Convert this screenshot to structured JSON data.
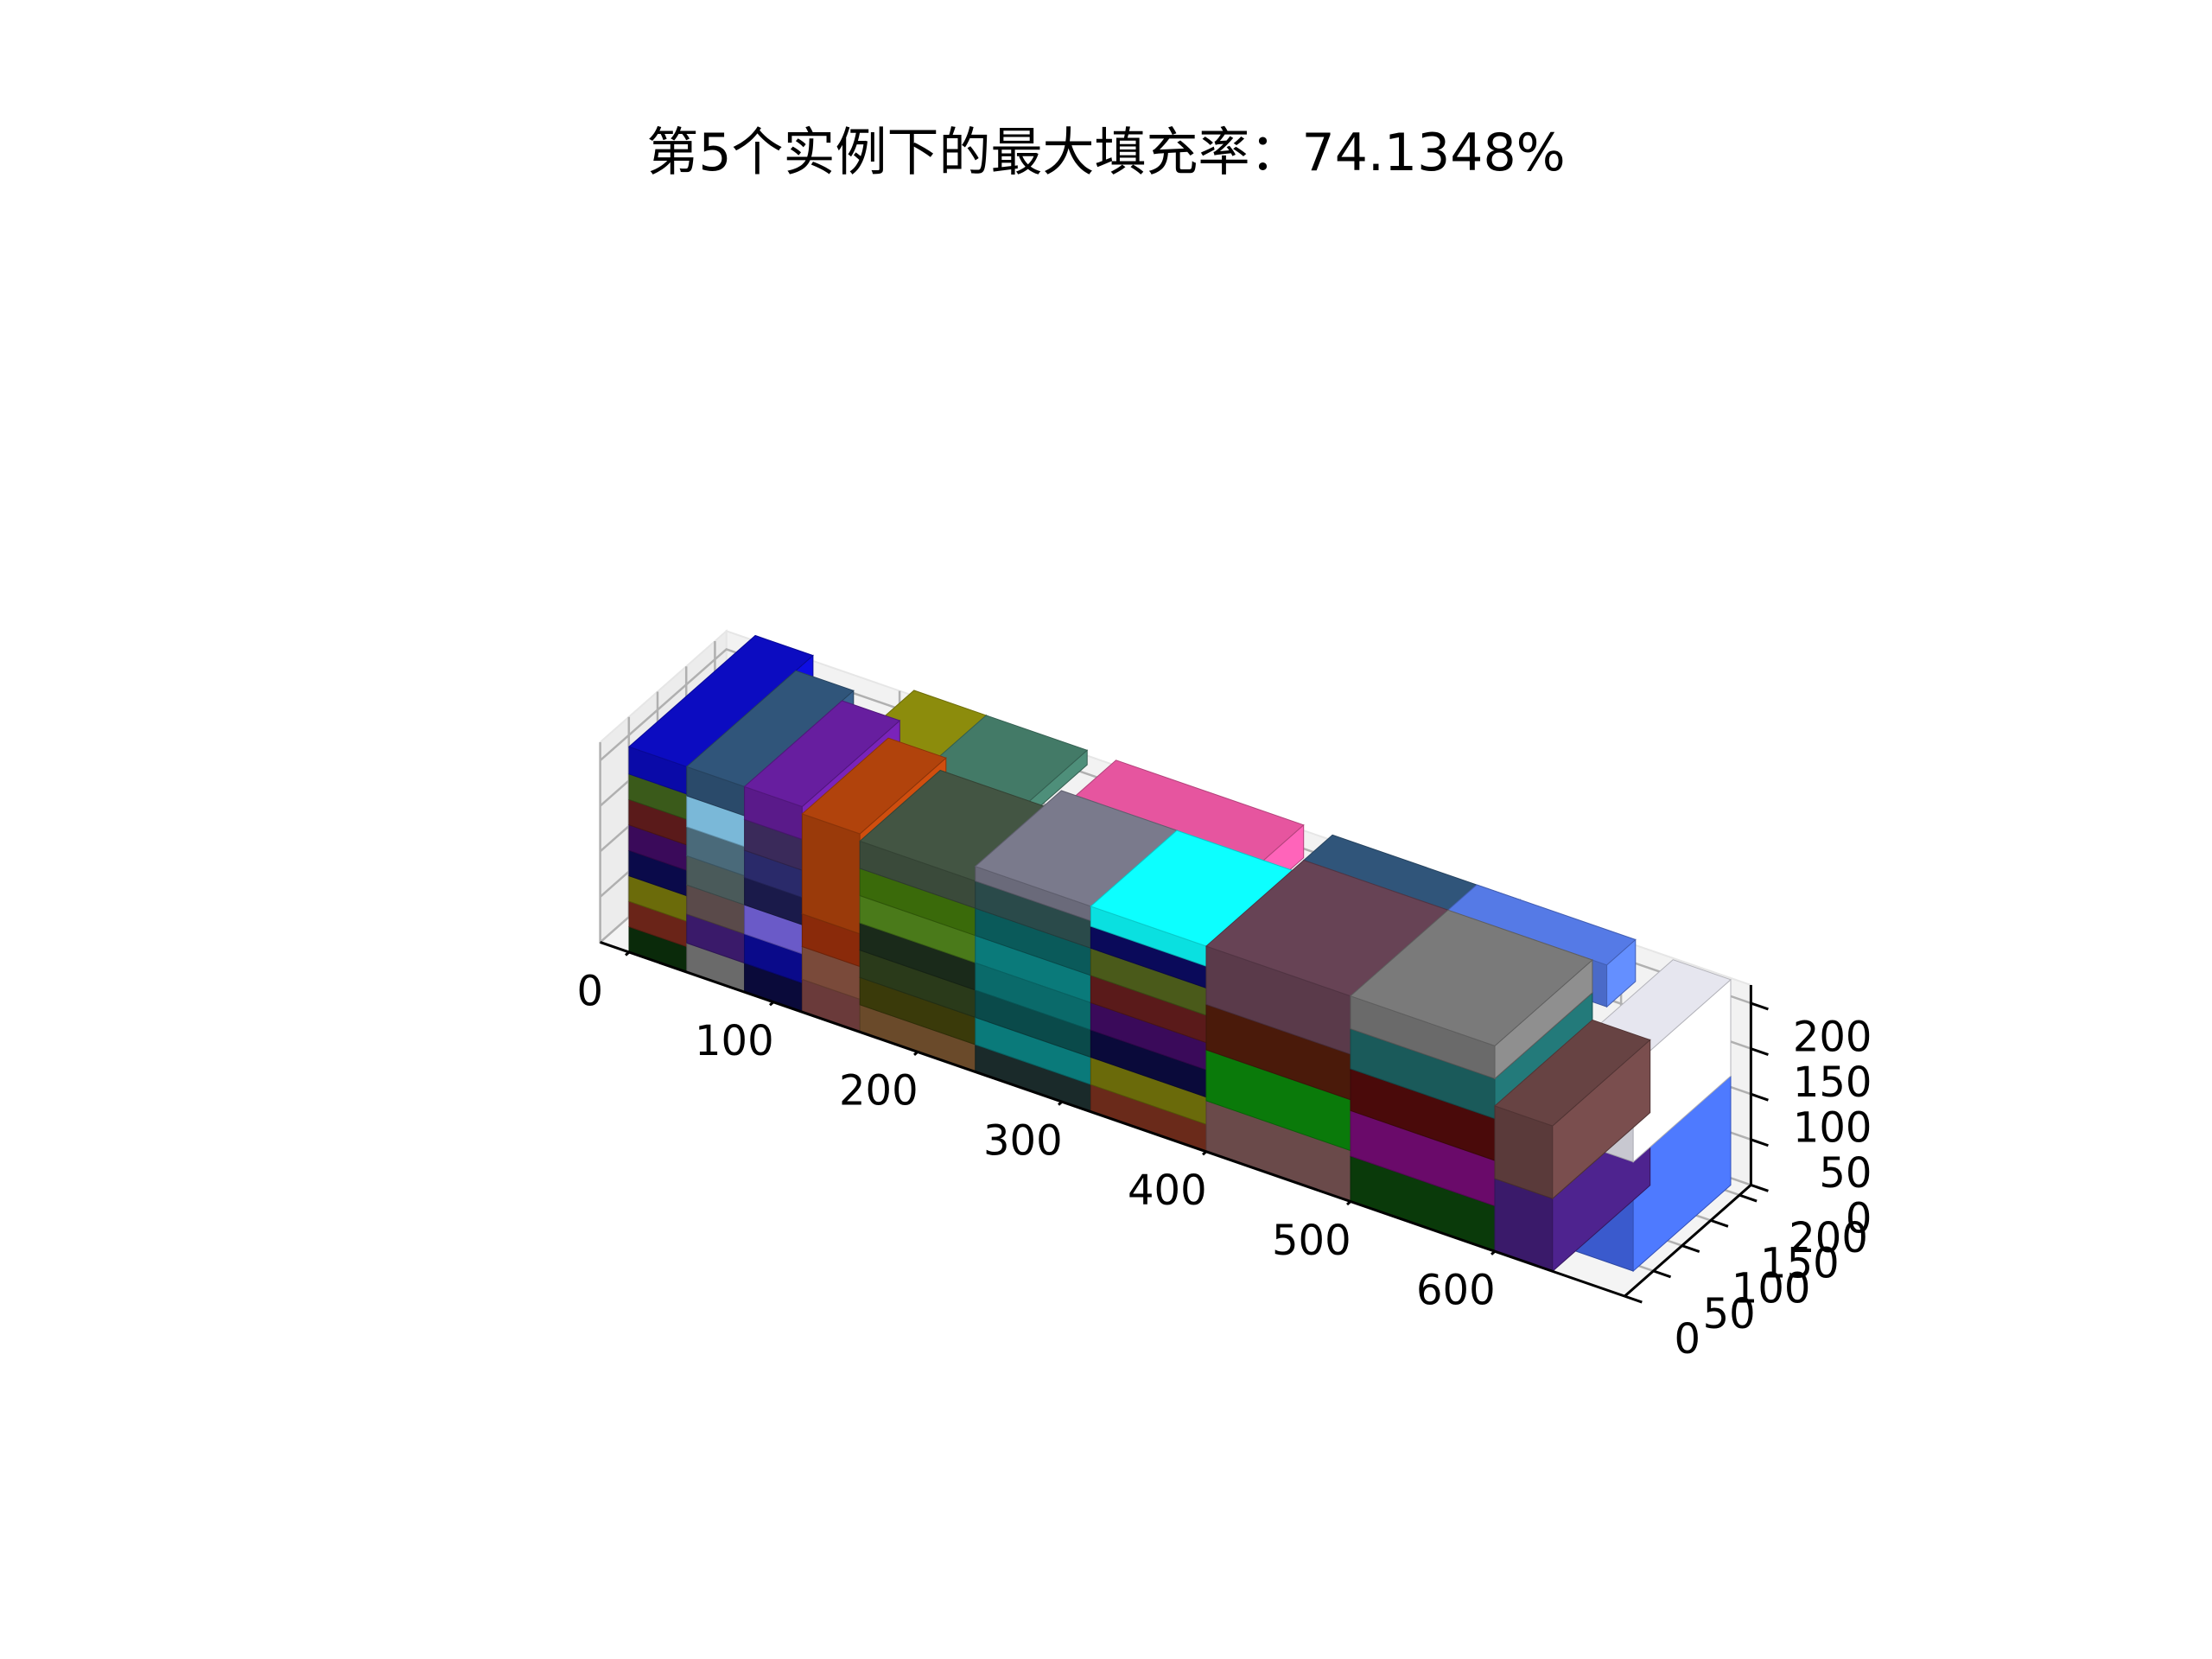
{
  "chart_data": {
    "type": "3d-bar",
    "title": "第5个实例下的最大填充率：74.1348%",
    "xlabel": "",
    "ylabel": "",
    "zlabel": "",
    "x_ticks": [
      "0",
      "100",
      "200",
      "300",
      "400",
      "500",
      "600"
    ],
    "y_ticks": [
      "0",
      "50",
      "100",
      "150",
      "200"
    ],
    "z_ticks": [
      "0",
      "50",
      "100",
      "150",
      "200"
    ],
    "xlim": [
      0,
      600
    ],
    "ylim": [
      0,
      220
    ],
    "zlim": [
      0,
      220
    ],
    "grid": true,
    "boxes": [
      {
        "x": 0,
        "y": 0,
        "z": 0,
        "dx": 40,
        "dy": 220,
        "dz": 28,
        "color": "#0a2a0a"
      },
      {
        "x": 0,
        "y": 0,
        "z": 28,
        "dx": 40,
        "dy": 220,
        "dz": 28,
        "color": "#6a2418"
      },
      {
        "x": 0,
        "y": 0,
        "z": 56,
        "dx": 40,
        "dy": 220,
        "dz": 28,
        "color": "#6b6b0a"
      },
      {
        "x": 0,
        "y": 0,
        "z": 84,
        "dx": 40,
        "dy": 220,
        "dz": 28,
        "color": "#0a0a4a"
      },
      {
        "x": 0,
        "y": 0,
        "z": 112,
        "dx": 40,
        "dy": 220,
        "dz": 28,
        "color": "#3a0a5a"
      },
      {
        "x": 0,
        "y": 0,
        "z": 140,
        "dx": 40,
        "dy": 220,
        "dz": 28,
        "color": "#5a1a1a"
      },
      {
        "x": 0,
        "y": 0,
        "z": 168,
        "dx": 40,
        "dy": 220,
        "dz": 28,
        "color": "#3a5a1a"
      },
      {
        "x": 0,
        "y": 0,
        "z": 196,
        "dx": 40,
        "dy": 220,
        "dz": 30,
        "color": "#0a0aa8"
      },
      {
        "x": 40,
        "y": 0,
        "z": 0,
        "dx": 40,
        "dy": 190,
        "dz": 32,
        "color": "#6a6a6a"
      },
      {
        "x": 40,
        "y": 0,
        "z": 32,
        "dx": 40,
        "dy": 190,
        "dz": 32,
        "color": "#3a1a6a"
      },
      {
        "x": 40,
        "y": 0,
        "z": 64,
        "dx": 40,
        "dy": 190,
        "dz": 32,
        "color": "#5a4a4a"
      },
      {
        "x": 40,
        "y": 0,
        "z": 96,
        "dx": 40,
        "dy": 190,
        "dz": 32,
        "color": "#4a5a5a"
      },
      {
        "x": 40,
        "y": 0,
        "z": 128,
        "dx": 40,
        "dy": 190,
        "dz": 32,
        "color": "#4a6a7a"
      },
      {
        "x": 40,
        "y": 0,
        "z": 160,
        "dx": 40,
        "dy": 190,
        "dz": 34,
        "color": "#7ab8d8"
      },
      {
        "x": 40,
        "y": 0,
        "z": 194,
        "dx": 40,
        "dy": 190,
        "dz": 32,
        "color": "#2a4a6a"
      },
      {
        "x": 80,
        "y": 0,
        "z": 0,
        "dx": 40,
        "dy": 170,
        "dz": 32,
        "color": "#0a0a3a"
      },
      {
        "x": 80,
        "y": 0,
        "z": 32,
        "dx": 40,
        "dy": 170,
        "dz": 32,
        "color": "#0a0a8a"
      },
      {
        "x": 80,
        "y": 0,
        "z": 64,
        "dx": 40,
        "dy": 170,
        "dz": 32,
        "color": "#6a5ac8"
      },
      {
        "x": 80,
        "y": 0,
        "z": 96,
        "dx": 40,
        "dy": 170,
        "dz": 30,
        "color": "#1a1a4a"
      },
      {
        "x": 80,
        "y": 0,
        "z": 126,
        "dx": 40,
        "dy": 170,
        "dz": 30,
        "color": "#2a2a6a"
      },
      {
        "x": 80,
        "y": 0,
        "z": 156,
        "dx": 40,
        "dy": 170,
        "dz": 34,
        "color": "#3a2a5a"
      },
      {
        "x": 80,
        "y": 0,
        "z": 190,
        "dx": 40,
        "dy": 170,
        "dz": 36,
        "color": "#5a1a8a"
      },
      {
        "x": 120,
        "y": 0,
        "z": 0,
        "dx": 40,
        "dy": 150,
        "dz": 36,
        "color": "#6a3a3a"
      },
      {
        "x": 120,
        "y": 0,
        "z": 36,
        "dx": 40,
        "dy": 150,
        "dz": 36,
        "color": "#7a4a3a"
      },
      {
        "x": 120,
        "y": 0,
        "z": 72,
        "dx": 40,
        "dy": 150,
        "dz": 36,
        "color": "#8a2a0a"
      },
      {
        "x": 120,
        "y": 0,
        "z": 108,
        "dx": 40,
        "dy": 150,
        "dz": 110,
        "color": "#9a3a0a"
      },
      {
        "x": 110,
        "y": 80,
        "z": 190,
        "dx": 50,
        "dy": 140,
        "dz": 36,
        "color": "#7a7a0a"
      },
      {
        "x": 160,
        "y": 0,
        "z": 0,
        "dx": 80,
        "dy": 140,
        "dz": 30,
        "color": "#6a4a2a"
      },
      {
        "x": 160,
        "y": 0,
        "z": 30,
        "dx": 80,
        "dy": 140,
        "dz": 30,
        "color": "#3a3a0a"
      },
      {
        "x": 160,
        "y": 0,
        "z": 60,
        "dx": 80,
        "dy": 140,
        "dz": 30,
        "color": "#2a3a1a"
      },
      {
        "x": 160,
        "y": 0,
        "z": 90,
        "dx": 80,
        "dy": 140,
        "dz": 30,
        "color": "#1a2a1a"
      },
      {
        "x": 160,
        "y": 0,
        "z": 120,
        "dx": 80,
        "dy": 140,
        "dz": 30,
        "color": "#4a7a1a"
      },
      {
        "x": 160,
        "y": 0,
        "z": 150,
        "dx": 80,
        "dy": 140,
        "dz": 30,
        "color": "#3a6a0a"
      },
      {
        "x": 160,
        "y": 0,
        "z": 180,
        "dx": 80,
        "dy": 140,
        "dz": 30,
        "color": "#3a4a3a"
      },
      {
        "x": 160,
        "y": 80,
        "z": 210,
        "dx": 70,
        "dy": 140,
        "dz": 16,
        "color": "#3a6a5a"
      },
      {
        "x": 160,
        "y": 140,
        "z": 0,
        "dx": 20,
        "dy": 80,
        "dz": 210,
        "color": "#5a2a0a"
      },
      {
        "x": 240,
        "y": 0,
        "z": 0,
        "dx": 80,
        "dy": 150,
        "dz": 30,
        "color": "#1a2a2a"
      },
      {
        "x": 240,
        "y": 0,
        "z": 30,
        "dx": 80,
        "dy": 150,
        "dz": 30,
        "color": "#0a7a7a"
      },
      {
        "x": 240,
        "y": 0,
        "z": 60,
        "dx": 80,
        "dy": 150,
        "dz": 30,
        "color": "#0a4a4a"
      },
      {
        "x": 240,
        "y": 0,
        "z": 90,
        "dx": 80,
        "dy": 150,
        "dz": 30,
        "color": "#0a6a6a"
      },
      {
        "x": 240,
        "y": 0,
        "z": 120,
        "dx": 80,
        "dy": 150,
        "dz": 30,
        "color": "#0a7a7a"
      },
      {
        "x": 240,
        "y": 0,
        "z": 150,
        "dx": 80,
        "dy": 150,
        "dz": 30,
        "color": "#0a5a5a"
      },
      {
        "x": 240,
        "y": 0,
        "z": 180,
        "dx": 80,
        "dy": 150,
        "dz": 30,
        "color": "#2a4a4a"
      },
      {
        "x": 240,
        "y": 0,
        "z": 210,
        "dx": 80,
        "dy": 150,
        "dz": 16,
        "color": "#6a6a7a"
      },
      {
        "x": 250,
        "y": 150,
        "z": 190,
        "dx": 130,
        "dy": 70,
        "dz": 36,
        "color": "#c84a8a"
      },
      {
        "x": 320,
        "y": 0,
        "z": 0,
        "dx": 80,
        "dy": 150,
        "dz": 30,
        "color": "#6a2a1a"
      },
      {
        "x": 320,
        "y": 0,
        "z": 30,
        "dx": 80,
        "dy": 150,
        "dz": 30,
        "color": "#6a6a0a"
      },
      {
        "x": 320,
        "y": 0,
        "z": 60,
        "dx": 80,
        "dy": 150,
        "dz": 30,
        "color": "#0a0a3a"
      },
      {
        "x": 320,
        "y": 0,
        "z": 90,
        "dx": 80,
        "dy": 150,
        "dz": 30,
        "color": "#3a0a5a"
      },
      {
        "x": 320,
        "y": 0,
        "z": 120,
        "dx": 80,
        "dy": 150,
        "dz": 30,
        "color": "#5a1a1a"
      },
      {
        "x": 320,
        "y": 0,
        "z": 150,
        "dx": 80,
        "dy": 150,
        "dz": 30,
        "color": "#4a5a1a"
      },
      {
        "x": 320,
        "y": 0,
        "z": 180,
        "dx": 80,
        "dy": 150,
        "dz": 24,
        "color": "#0a0a5a"
      },
      {
        "x": 320,
        "y": 0,
        "z": 204,
        "dx": 80,
        "dy": 150,
        "dz": 22,
        "color": "#0ae0e0"
      },
      {
        "x": 400,
        "y": 0,
        "z": 0,
        "dx": 100,
        "dy": 170,
        "dz": 56,
        "color": "#6a4a4a"
      },
      {
        "x": 400,
        "y": 0,
        "z": 56,
        "dx": 100,
        "dy": 170,
        "dz": 56,
        "color": "#0a7a0a"
      },
      {
        "x": 400,
        "y": 0,
        "z": 112,
        "dx": 100,
        "dy": 170,
        "dz": 50,
        "color": "#4a1a0a"
      },
      {
        "x": 400,
        "y": 0,
        "z": 162,
        "dx": 100,
        "dy": 170,
        "dz": 64,
        "color": "#5a3a4a"
      },
      {
        "x": 400,
        "y": 170,
        "z": 180,
        "dx": 130,
        "dy": 50,
        "dz": 46,
        "color": "#2a4a6a"
      },
      {
        "x": 500,
        "y": 0,
        "z": 0,
        "dx": 100,
        "dy": 170,
        "dz": 50,
        "color": "#0a3a0a"
      },
      {
        "x": 500,
        "y": 0,
        "z": 50,
        "dx": 100,
        "dy": 170,
        "dz": 50,
        "color": "#6a0a6a"
      },
      {
        "x": 500,
        "y": 0,
        "z": 100,
        "dx": 100,
        "dy": 170,
        "dz": 46,
        "color": "#4a0a0a"
      },
      {
        "x": 500,
        "y": 0,
        "z": 146,
        "dx": 100,
        "dy": 170,
        "dz": 44,
        "color": "#1a5a5a"
      },
      {
        "x": 500,
        "y": 0,
        "z": 190,
        "dx": 100,
        "dy": 170,
        "dz": 36,
        "color": "#6a6a6a"
      },
      {
        "x": 500,
        "y": 170,
        "z": 180,
        "dx": 110,
        "dy": 50,
        "dz": 46,
        "color": "#4a6ac8"
      },
      {
        "x": 600,
        "y": 0,
        "z": 0,
        "dx": 40,
        "dy": 170,
        "dz": 80,
        "color": "#3a1a6a"
      },
      {
        "x": 600,
        "y": 0,
        "z": 80,
        "dx": 40,
        "dy": 170,
        "dz": 80,
        "color": "#5a3a3a"
      },
      {
        "x": 640,
        "y": 40,
        "z": 0,
        "dx": 40,
        "dy": 170,
        "dz": 120,
        "color": "#3a5acd"
      },
      {
        "x": 640,
        "y": 40,
        "z": 120,
        "dx": 40,
        "dy": 170,
        "dz": 106,
        "color": "#c8c8d0"
      }
    ]
  }
}
